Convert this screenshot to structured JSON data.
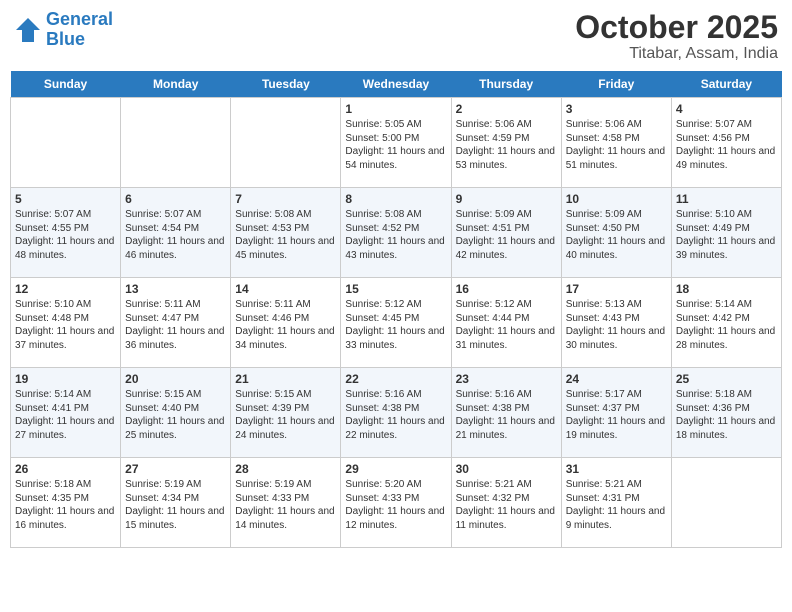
{
  "header": {
    "logo_line1": "General",
    "logo_line2": "Blue",
    "title": "October 2025",
    "subtitle": "Titabar, Assam, India"
  },
  "days_of_week": [
    "Sunday",
    "Monday",
    "Tuesday",
    "Wednesday",
    "Thursday",
    "Friday",
    "Saturday"
  ],
  "weeks": [
    [
      {
        "day": "",
        "sunrise": "",
        "sunset": "",
        "daylight": ""
      },
      {
        "day": "",
        "sunrise": "",
        "sunset": "",
        "daylight": ""
      },
      {
        "day": "",
        "sunrise": "",
        "sunset": "",
        "daylight": ""
      },
      {
        "day": "1",
        "sunrise": "Sunrise: 5:05 AM",
        "sunset": "Sunset: 5:00 PM",
        "daylight": "Daylight: 11 hours and 54 minutes."
      },
      {
        "day": "2",
        "sunrise": "Sunrise: 5:06 AM",
        "sunset": "Sunset: 4:59 PM",
        "daylight": "Daylight: 11 hours and 53 minutes."
      },
      {
        "day": "3",
        "sunrise": "Sunrise: 5:06 AM",
        "sunset": "Sunset: 4:58 PM",
        "daylight": "Daylight: 11 hours and 51 minutes."
      },
      {
        "day": "4",
        "sunrise": "Sunrise: 5:07 AM",
        "sunset": "Sunset: 4:56 PM",
        "daylight": "Daylight: 11 hours and 49 minutes."
      }
    ],
    [
      {
        "day": "5",
        "sunrise": "Sunrise: 5:07 AM",
        "sunset": "Sunset: 4:55 PM",
        "daylight": "Daylight: 11 hours and 48 minutes."
      },
      {
        "day": "6",
        "sunrise": "Sunrise: 5:07 AM",
        "sunset": "Sunset: 4:54 PM",
        "daylight": "Daylight: 11 hours and 46 minutes."
      },
      {
        "day": "7",
        "sunrise": "Sunrise: 5:08 AM",
        "sunset": "Sunset: 4:53 PM",
        "daylight": "Daylight: 11 hours and 45 minutes."
      },
      {
        "day": "8",
        "sunrise": "Sunrise: 5:08 AM",
        "sunset": "Sunset: 4:52 PM",
        "daylight": "Daylight: 11 hours and 43 minutes."
      },
      {
        "day": "9",
        "sunrise": "Sunrise: 5:09 AM",
        "sunset": "Sunset: 4:51 PM",
        "daylight": "Daylight: 11 hours and 42 minutes."
      },
      {
        "day": "10",
        "sunrise": "Sunrise: 5:09 AM",
        "sunset": "Sunset: 4:50 PM",
        "daylight": "Daylight: 11 hours and 40 minutes."
      },
      {
        "day": "11",
        "sunrise": "Sunrise: 5:10 AM",
        "sunset": "Sunset: 4:49 PM",
        "daylight": "Daylight: 11 hours and 39 minutes."
      }
    ],
    [
      {
        "day": "12",
        "sunrise": "Sunrise: 5:10 AM",
        "sunset": "Sunset: 4:48 PM",
        "daylight": "Daylight: 11 hours and 37 minutes."
      },
      {
        "day": "13",
        "sunrise": "Sunrise: 5:11 AM",
        "sunset": "Sunset: 4:47 PM",
        "daylight": "Daylight: 11 hours and 36 minutes."
      },
      {
        "day": "14",
        "sunrise": "Sunrise: 5:11 AM",
        "sunset": "Sunset: 4:46 PM",
        "daylight": "Daylight: 11 hours and 34 minutes."
      },
      {
        "day": "15",
        "sunrise": "Sunrise: 5:12 AM",
        "sunset": "Sunset: 4:45 PM",
        "daylight": "Daylight: 11 hours and 33 minutes."
      },
      {
        "day": "16",
        "sunrise": "Sunrise: 5:12 AM",
        "sunset": "Sunset: 4:44 PM",
        "daylight": "Daylight: 11 hours and 31 minutes."
      },
      {
        "day": "17",
        "sunrise": "Sunrise: 5:13 AM",
        "sunset": "Sunset: 4:43 PM",
        "daylight": "Daylight: 11 hours and 30 minutes."
      },
      {
        "day": "18",
        "sunrise": "Sunrise: 5:14 AM",
        "sunset": "Sunset: 4:42 PM",
        "daylight": "Daylight: 11 hours and 28 minutes."
      }
    ],
    [
      {
        "day": "19",
        "sunrise": "Sunrise: 5:14 AM",
        "sunset": "Sunset: 4:41 PM",
        "daylight": "Daylight: 11 hours and 27 minutes."
      },
      {
        "day": "20",
        "sunrise": "Sunrise: 5:15 AM",
        "sunset": "Sunset: 4:40 PM",
        "daylight": "Daylight: 11 hours and 25 minutes."
      },
      {
        "day": "21",
        "sunrise": "Sunrise: 5:15 AM",
        "sunset": "Sunset: 4:39 PM",
        "daylight": "Daylight: 11 hours and 24 minutes."
      },
      {
        "day": "22",
        "sunrise": "Sunrise: 5:16 AM",
        "sunset": "Sunset: 4:38 PM",
        "daylight": "Daylight: 11 hours and 22 minutes."
      },
      {
        "day": "23",
        "sunrise": "Sunrise: 5:16 AM",
        "sunset": "Sunset: 4:38 PM",
        "daylight": "Daylight: 11 hours and 21 minutes."
      },
      {
        "day": "24",
        "sunrise": "Sunrise: 5:17 AM",
        "sunset": "Sunset: 4:37 PM",
        "daylight": "Daylight: 11 hours and 19 minutes."
      },
      {
        "day": "25",
        "sunrise": "Sunrise: 5:18 AM",
        "sunset": "Sunset: 4:36 PM",
        "daylight": "Daylight: 11 hours and 18 minutes."
      }
    ],
    [
      {
        "day": "26",
        "sunrise": "Sunrise: 5:18 AM",
        "sunset": "Sunset: 4:35 PM",
        "daylight": "Daylight: 11 hours and 16 minutes."
      },
      {
        "day": "27",
        "sunrise": "Sunrise: 5:19 AM",
        "sunset": "Sunset: 4:34 PM",
        "daylight": "Daylight: 11 hours and 15 minutes."
      },
      {
        "day": "28",
        "sunrise": "Sunrise: 5:19 AM",
        "sunset": "Sunset: 4:33 PM",
        "daylight": "Daylight: 11 hours and 14 minutes."
      },
      {
        "day": "29",
        "sunrise": "Sunrise: 5:20 AM",
        "sunset": "Sunset: 4:33 PM",
        "daylight": "Daylight: 11 hours and 12 minutes."
      },
      {
        "day": "30",
        "sunrise": "Sunrise: 5:21 AM",
        "sunset": "Sunset: 4:32 PM",
        "daylight": "Daylight: 11 hours and 11 minutes."
      },
      {
        "day": "31",
        "sunrise": "Sunrise: 5:21 AM",
        "sunset": "Sunset: 4:31 PM",
        "daylight": "Daylight: 11 hours and 9 minutes."
      },
      {
        "day": "",
        "sunrise": "",
        "sunset": "",
        "daylight": ""
      }
    ]
  ]
}
